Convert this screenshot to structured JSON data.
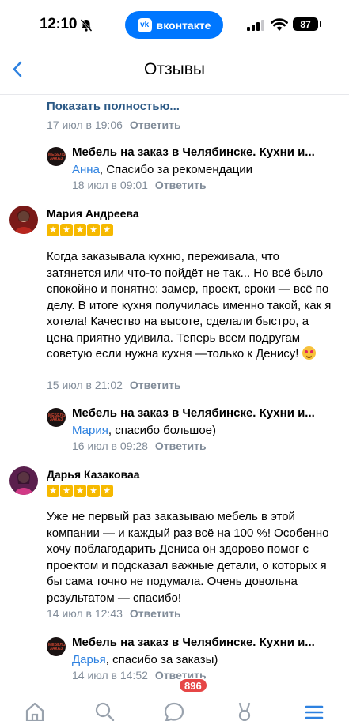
{
  "status": {
    "time": "12:10",
    "app_pill": "вконтакте",
    "battery": "87"
  },
  "nav": {
    "title": "Отзывы"
  },
  "top_comment": {
    "show_full": "Показать полностью...",
    "date": "17 июл в 19:06",
    "reply_label": "Ответить"
  },
  "replies": [
    {
      "author": "Мебель на заказ в Челябинске. Кухни и...",
      "mention": "Анна",
      "text": ", Спасибо за рекомендации",
      "date": "18 июл в 09:01",
      "reply_label": "Ответить"
    },
    {
      "author": "Мебель на заказ в Челябинске. Кухни и...",
      "mention": "Мария",
      "text": ", спасибо большое)",
      "date": "16 июл в 09:28",
      "reply_label": "Ответить"
    },
    {
      "author": "Мебель на заказ в Челябинске. Кухни и...",
      "mention": "Дарья",
      "text": ", спасибо за заказы)",
      "date": "14 июл в 14:52",
      "reply_label": "Ответить"
    }
  ],
  "comments": [
    {
      "author": "Мария Андреева",
      "rating": 5,
      "text": "Когда заказывала кухню, переживала, что затянется или что-то пойдёт не так... Но всё было спокойно и понятно: замер, проект, сроки — всё по делу. В итоге кухня получилась именно такой, как я хотела! Качество на высоте, сделали быстро, а цена приятно удивила. Теперь всем подругам советую если нужна кухня —только к Денису!",
      "date": "15 июл в 21:02",
      "reply_label": "Ответить"
    },
    {
      "author": "Дарья Казаковаа",
      "rating": 5,
      "text": "Уже не первый раз заказываю мебель в этой компании — и каждый раз всё на 100 %! Особенно хочу поблагодарить Дениса он здорово помог с проектом и подсказал важные детали, о которых я бы сама точно не подумала. Очень довольна результатом — спасибо!",
      "date": "14 июл в 12:43",
      "reply_label": "Ответить"
    }
  ],
  "tabbar": {
    "messages_badge": "896"
  },
  "colors": {
    "accent": "#2a5885",
    "mention": "#2d81e0",
    "meta": "#818c99",
    "star": "#f6b900",
    "badge": "#e64646",
    "vk_blue": "#0077ff"
  },
  "icons": [
    "bell-slash-icon",
    "vk-logo-icon",
    "signal-icon",
    "wifi-icon",
    "battery-icon",
    "back-chevron-icon",
    "home-icon",
    "search-icon",
    "messages-icon",
    "clips-icon",
    "menu-icon",
    "smile-emoji-icon",
    "star-icon"
  ]
}
